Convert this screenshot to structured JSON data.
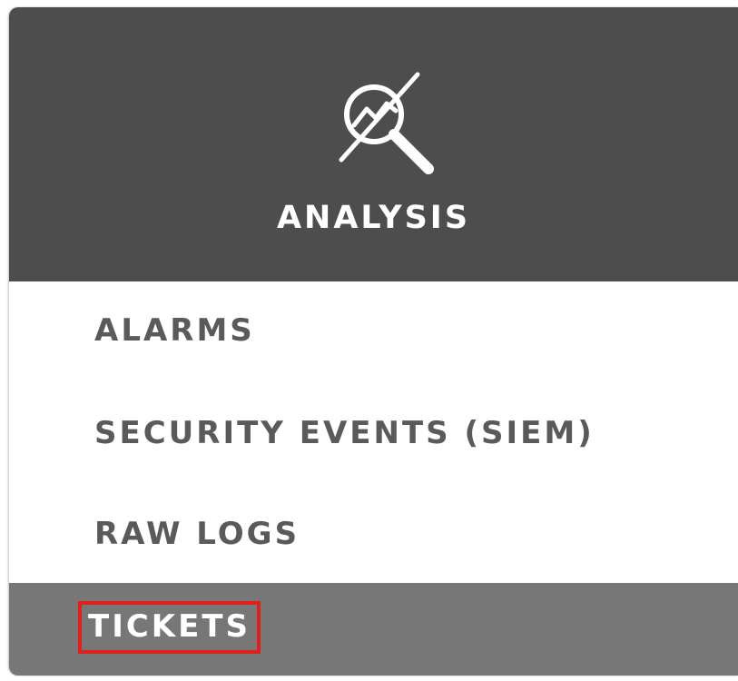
{
  "menu": {
    "title": "ANALYSIS",
    "icon": "analysis-magnifier-chart-icon",
    "items": [
      {
        "label": "ALARMS",
        "active": false
      },
      {
        "label": "SECURITY EVENTS (SIEM)",
        "active": false
      },
      {
        "label": "RAW LOGS",
        "active": false
      },
      {
        "label": "TICKETS",
        "active": true,
        "highlighted": true
      }
    ]
  },
  "colors": {
    "header_bg": "#4d4d4d",
    "active_bg": "#777777",
    "item_text": "#5a5a5a",
    "highlight_border": "#e0201b"
  }
}
